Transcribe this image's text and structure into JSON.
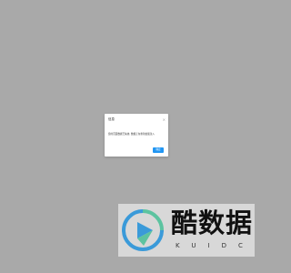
{
  "colors": {
    "overlay": "#a9a9a9",
    "dialog_bg": "#ffffff",
    "confirm_button": "#2196f3",
    "logo_blue": "#3a9ad9",
    "logo_green": "#5cc3a0"
  },
  "dialog": {
    "title": "信息",
    "close_icon": "close-icon",
    "message": "您的页面数据已失效, 数据正在重新加载注入",
    "confirm_label": "确定"
  },
  "watermark": {
    "brand_text": "酷数据",
    "brand_sub": "KUIDC",
    "logo_icon": "play-icon"
  }
}
